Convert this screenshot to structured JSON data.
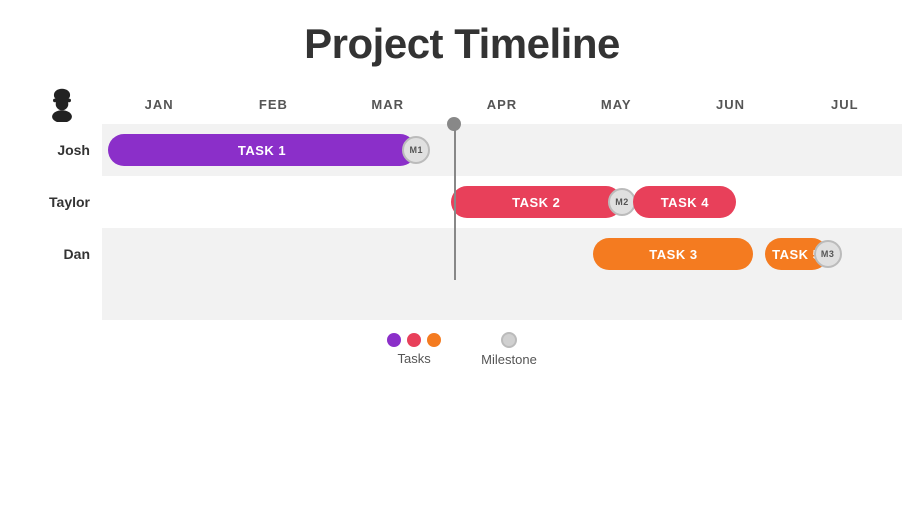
{
  "title": "Project Timeline",
  "months": [
    "JAN",
    "FEB",
    "MAR",
    "APR",
    "MAY",
    "JUN",
    "JUL"
  ],
  "persons": [
    {
      "name": "Josh"
    },
    {
      "name": "Taylor"
    },
    {
      "name": "Dan"
    }
  ],
  "tasks": {
    "task1": {
      "label": "TASK 1",
      "color": "#8B2FC9",
      "row": 0,
      "startMonth": 0,
      "startFrac": 0.05,
      "endMonth": 2,
      "endFrac": 0.75,
      "milestone": "M1"
    },
    "task2": {
      "label": "TASK 2",
      "color": "#E8405A",
      "row": 1,
      "startMonth": 3,
      "startFrac": 0.05,
      "endMonth": 4,
      "endFrac": 0.55,
      "milestone": "M2"
    },
    "task4": {
      "label": "TASK 4",
      "color": "#E8405A",
      "row": 1,
      "startMonth": 4,
      "startFrac": 0.65,
      "endMonth": 5,
      "endFrac": 0.55,
      "milestone": null
    },
    "task3": {
      "label": "TASK 3",
      "color": "#F47B20",
      "row": 2,
      "startMonth": 4,
      "startFrac": 0.3,
      "endMonth": 5,
      "endFrac": 0.7,
      "milestone": null
    },
    "task5": {
      "label": "TASK 5",
      "color": "#F47B20",
      "row": 2,
      "startMonth": 5,
      "startFrac": 0.8,
      "endMonth": 6,
      "endFrac": 0.35,
      "milestone": "M3"
    }
  },
  "todayMonth": 3,
  "todayFrac": 0.08,
  "legend": {
    "tasks_label": "Tasks",
    "milestone_label": "Milestone",
    "task_colors": [
      "#8B2FC9",
      "#E8405A",
      "#F47B20"
    ]
  }
}
